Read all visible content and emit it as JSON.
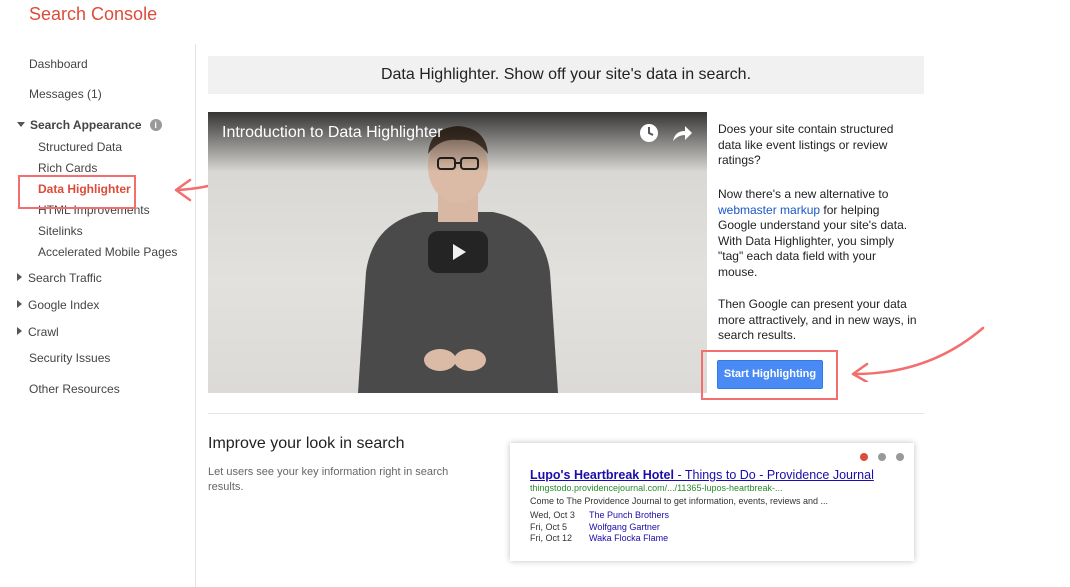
{
  "app": {
    "title": "Search Console"
  },
  "sidebar": {
    "dashboard": "Dashboard",
    "messages": "Messages (1)",
    "search_appearance": "Search Appearance",
    "search_appearance_items": [
      "Structured Data",
      "Rich Cards",
      "Data Highlighter",
      "HTML Improvements",
      "Sitelinks",
      "Accelerated Mobile Pages"
    ],
    "search_traffic": "Search Traffic",
    "google_index": "Google Index",
    "crawl": "Crawl",
    "security_issues": "Security Issues",
    "other_resources": "Other Resources"
  },
  "banner": {
    "text": "Data Highlighter. Show off your site's data in search."
  },
  "video": {
    "title": "Introduction to Data Highlighter",
    "icons": [
      "clock-icon",
      "share-icon",
      "play-icon"
    ]
  },
  "intro": {
    "p1": "Does your site contain structured data like event listings or review ratings?",
    "p2_before": "Now there's a new alternative to ",
    "p2_link": "webmaster markup",
    "p2_after": " for helping Google understand your site's data. With Data Highlighter, you simply \"tag\" each data field with your mouse.",
    "p3": "Then Google can present your data more attractively, and in new ways, in search results."
  },
  "start_button": {
    "label": "Start Highlighting"
  },
  "improve": {
    "title": "Improve your look in search",
    "desc": "Let users see your key information right in search results."
  },
  "example": {
    "title_bold": "Lupo's Heartbreak Hotel",
    "title_rest": " - Things to Do - Providence Journal",
    "url": "thingstodo.providencejournal.com/.../11365-lupos-heartbreak-...",
    "snippet": "Come to The Providence Journal to get information, events, reviews and ...",
    "events": [
      {
        "date": "Wed, Oct 3",
        "name": "The Punch Brothers"
      },
      {
        "date": "Fri, Oct 5",
        "name": "Wolfgang Gartner"
      },
      {
        "date": "Fri, Oct 12",
        "name": "Waka Flocka Flame"
      }
    ],
    "carousel_dots": [
      "#dd4b39",
      "#999999",
      "#999999"
    ]
  },
  "colors": {
    "brand": "#dd4b39",
    "annotation": "#f36e6e",
    "button": "#4a8af4",
    "link": "#1a55c7"
  }
}
